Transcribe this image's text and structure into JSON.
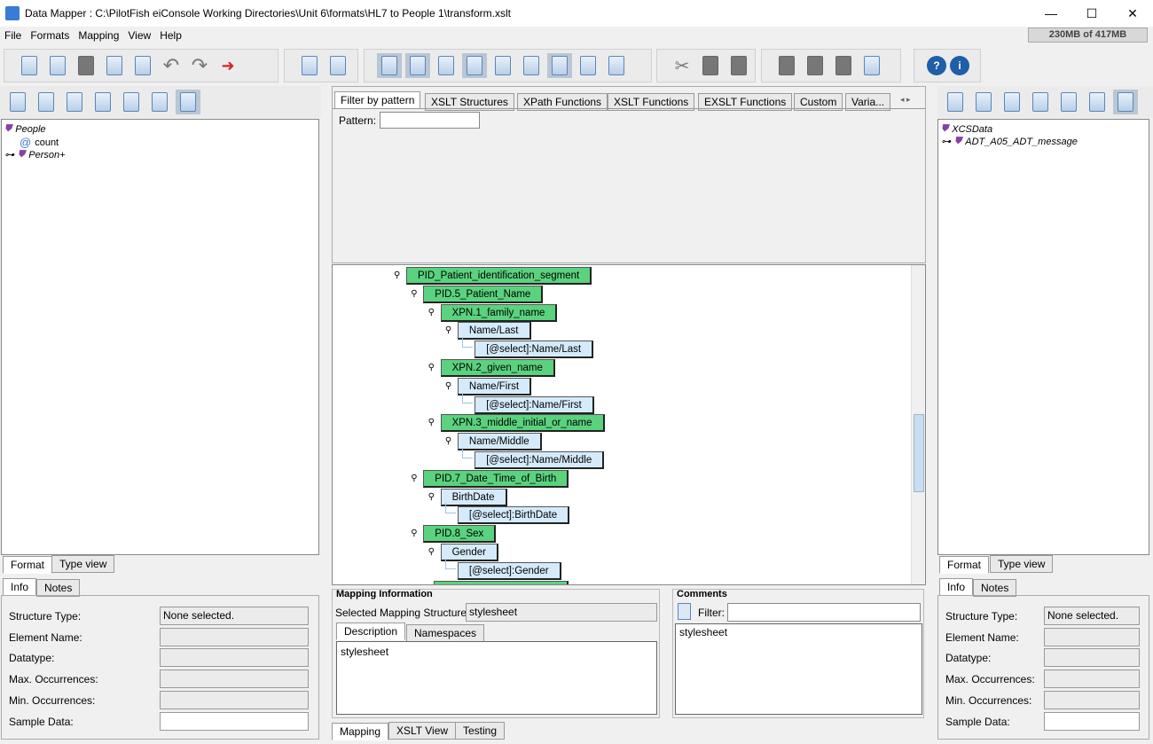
{
  "window": {
    "title": "Data Mapper : C:\\PilotFish eiConsole Working Directories\\Unit 6\\formats\\HL7 to People 1\\transform.xslt",
    "memory": "230MB of 417MB"
  },
  "menu": [
    "File",
    "Formats",
    "Mapping",
    "View",
    "Help"
  ],
  "left": {
    "tree": [
      {
        "label": "People",
        "icon": "element-icon"
      },
      {
        "label": "count",
        "icon": "attribute-icon"
      },
      {
        "label": "Person+",
        "icon": "element-icon"
      }
    ],
    "tabs": [
      "Format",
      "Type view"
    ],
    "info_tabs": [
      "Info",
      "Notes"
    ],
    "fields": [
      {
        "label": "Structure Type:",
        "value": "None selected."
      },
      {
        "label": "Element Name:",
        "value": ""
      },
      {
        "label": "Datatype:",
        "value": ""
      },
      {
        "label": "Max. Occurrences:",
        "value": ""
      },
      {
        "label": "Min. Occurrences:",
        "value": ""
      },
      {
        "label": "Sample Data:",
        "value": ""
      }
    ]
  },
  "right": {
    "tree": [
      {
        "label": "XCSData"
      },
      {
        "label": "ADT_A05_ADT_message"
      }
    ],
    "tabs": [
      "Format",
      "Type view"
    ],
    "info_tabs": [
      "Info",
      "Notes"
    ],
    "fields": [
      {
        "label": "Structure Type:",
        "value": "None selected."
      },
      {
        "label": "Element Name:",
        "value": ""
      },
      {
        "label": "Datatype:",
        "value": ""
      },
      {
        "label": "Max. Occurrences:",
        "value": ""
      },
      {
        "label": "Min. Occurrences:",
        "value": ""
      },
      {
        "label": "Sample Data:",
        "value": ""
      }
    ]
  },
  "center": {
    "tabs": [
      "Filter by pattern",
      "XSLT Structures",
      "XPath Functions",
      "XSLT Functions",
      "EXSLT Functions",
      "Custom",
      "Varia..."
    ],
    "pattern_label": "Pattern:",
    "pattern_value": "",
    "nodes": [
      {
        "label": "PID_Patient_identification_segment",
        "kind": "segment"
      },
      {
        "label": "PID.5_Patient_Name",
        "kind": "segment"
      },
      {
        "label": "XPN.1_family_name",
        "kind": "segment"
      },
      {
        "label": "Name/Last",
        "kind": "target"
      },
      {
        "label": "[@select]:Name/Last",
        "kind": "target"
      },
      {
        "label": "XPN.2_given_name",
        "kind": "segment"
      },
      {
        "label": "Name/First",
        "kind": "target"
      },
      {
        "label": "[@select]:Name/First",
        "kind": "target"
      },
      {
        "label": "XPN.3_middle_initial_or_name",
        "kind": "segment"
      },
      {
        "label": "Name/Middle",
        "kind": "target"
      },
      {
        "label": "[@select]:Name/Middle",
        "kind": "target"
      },
      {
        "label": "PID.7_Date_Time_of_Birth",
        "kind": "segment"
      },
      {
        "label": "BirthDate",
        "kind": "target"
      },
      {
        "label": "[@select]:BirthDate",
        "kind": "target"
      },
      {
        "label": "PID.8_Sex",
        "kind": "segment"
      },
      {
        "label": "Gender",
        "kind": "target"
      },
      {
        "label": "[@select]:Gender",
        "kind": "target"
      }
    ],
    "mapping_info": {
      "title": "Mapping Information",
      "selected_label": "Selected Mapping Structure:",
      "selected_value": "stylesheet",
      "tabs": [
        "Description",
        "Namespaces"
      ],
      "description": "stylesheet"
    },
    "comments": {
      "title": "Comments",
      "filter_label": "Filter:",
      "filter_value": "",
      "text": "stylesheet"
    },
    "bottom_tabs": [
      "Mapping",
      "XSLT View",
      "Testing"
    ]
  },
  "colors": {
    "segment": "#5ad27e",
    "target": "#d5ebfb",
    "selected_tool": "#b9c6d4"
  }
}
